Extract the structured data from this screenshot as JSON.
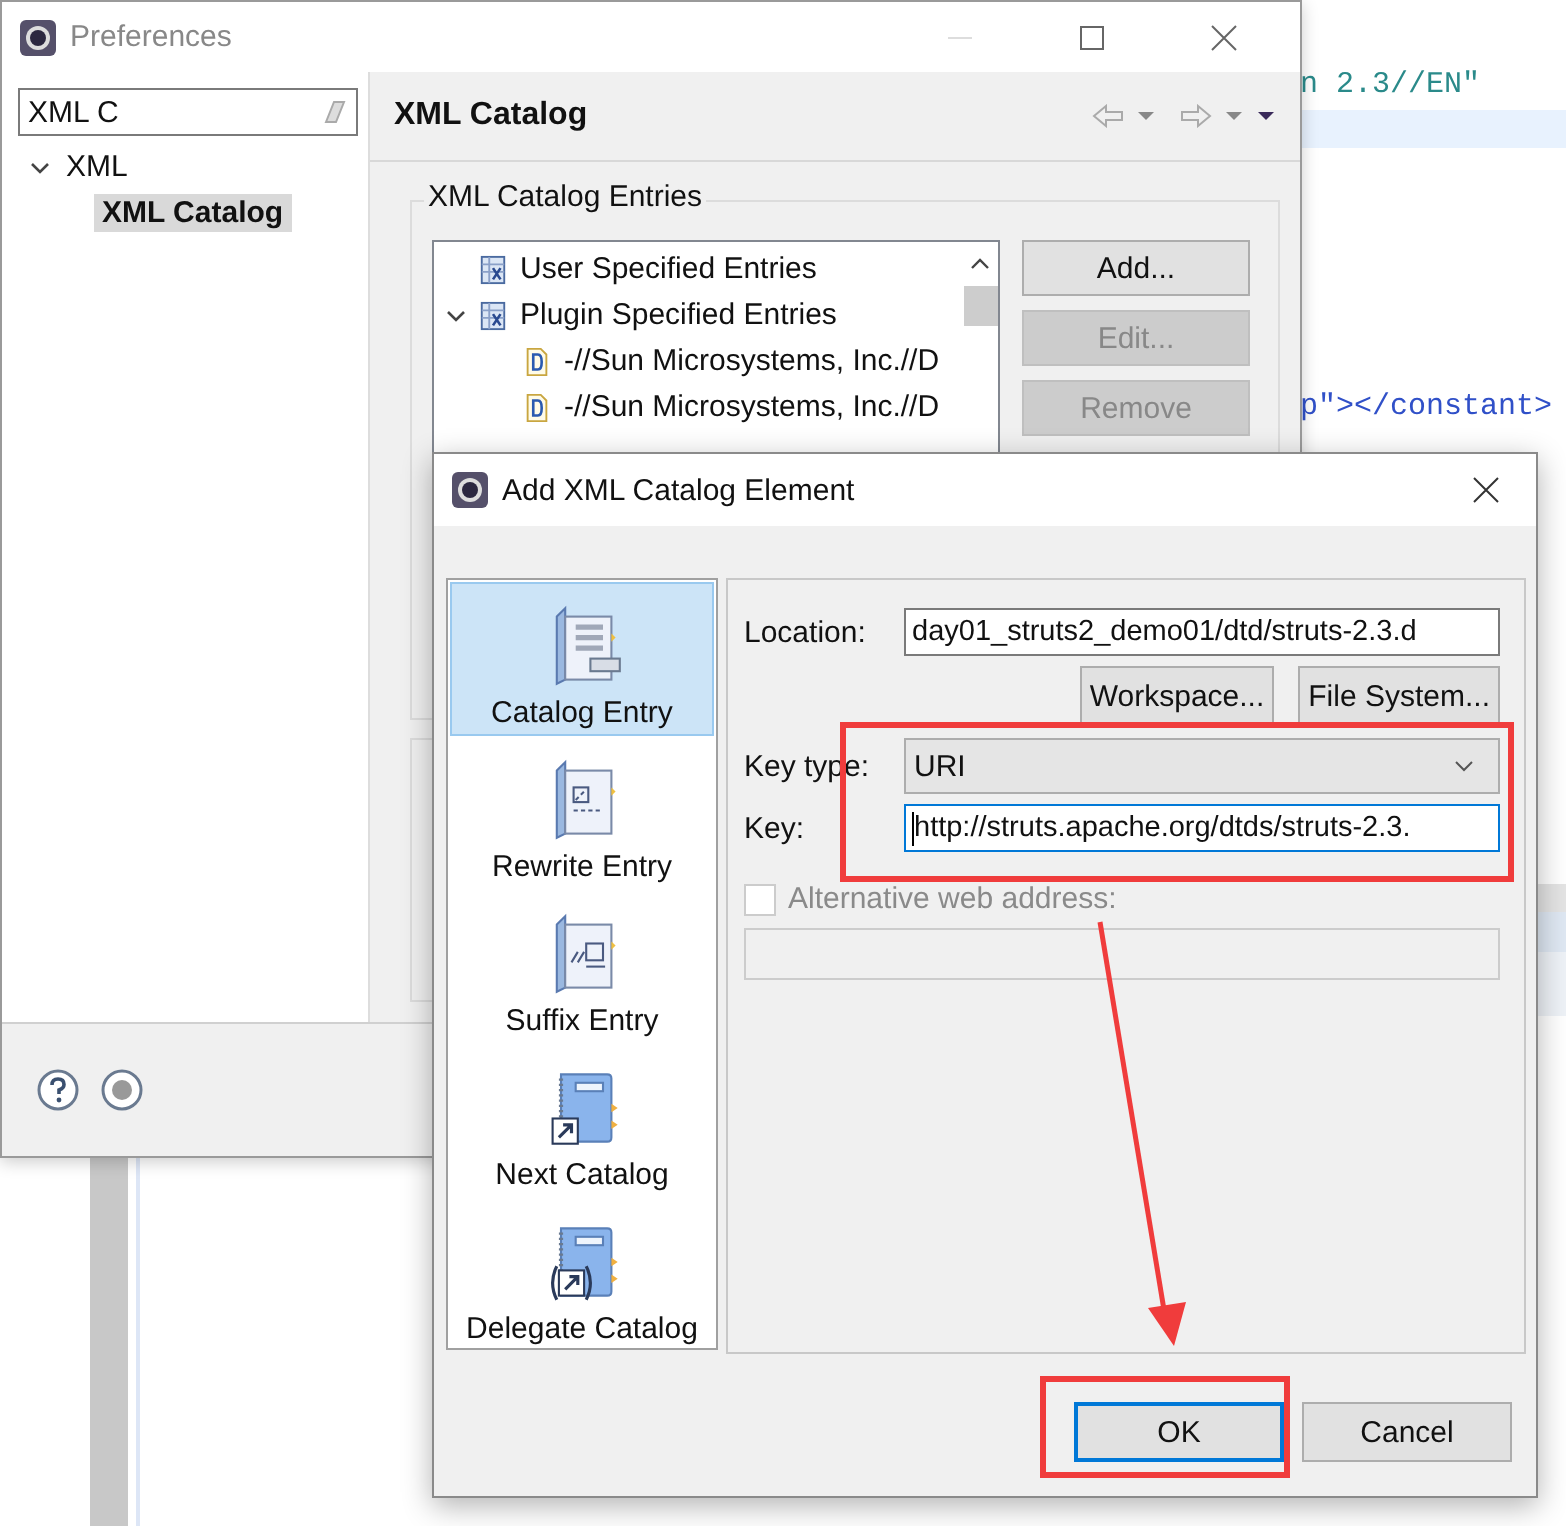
{
  "editor": {
    "lines": [
      {
        "text": "n 2.3//EN\"",
        "kind": "string"
      },
      {
        "text": "p\"></constant>",
        "kind": "tag"
      }
    ]
  },
  "preferences": {
    "title": "Preferences",
    "filter": {
      "value": "XML C"
    },
    "tree": [
      {
        "label": "XML",
        "expanded": true,
        "children": [
          {
            "label": "XML Catalog",
            "selected": true
          }
        ]
      }
    ],
    "page_title": "XML Catalog",
    "group_title": "XML Catalog Entries",
    "entries": [
      {
        "label": "User Specified Entries",
        "kind": "catalog"
      },
      {
        "label": "Plugin Specified Entries",
        "kind": "catalog",
        "expanded": true,
        "children": [
          {
            "label": "-//Sun Microsystems, Inc.//D",
            "kind": "dtd"
          },
          {
            "label": "-//Sun Microsystems, Inc.//D",
            "kind": "dtd"
          }
        ]
      }
    ],
    "buttons": [
      {
        "label": "Add...",
        "disabled": false
      },
      {
        "label": "Edit...",
        "disabled": true
      },
      {
        "label": "Remove",
        "disabled": true
      }
    ]
  },
  "dialog": {
    "title": "Add XML Catalog Element",
    "types": [
      {
        "label": "Catalog Entry",
        "kind": "entry",
        "selected": true
      },
      {
        "label": "Rewrite Entry",
        "kind": "rewrite",
        "selected": false
      },
      {
        "label": "Suffix Entry",
        "kind": "suffix",
        "selected": false
      },
      {
        "label": "Next Catalog",
        "kind": "next",
        "selected": false
      },
      {
        "label": "Delegate Catalog",
        "kind": "delegate",
        "selected": false
      }
    ],
    "location": {
      "label": "Location:",
      "value": "day01_struts2_demo01/dtd/struts-2.3.d"
    },
    "browse_buttons": [
      "Workspace...",
      "File System..."
    ],
    "key_type": {
      "label": "Key type:",
      "value": "URI"
    },
    "key": {
      "label": "Key:",
      "value": "http://struts.apache.org/dtds/struts-2.3.",
      "focused": true
    },
    "alternative": {
      "label": "Alternative web address:",
      "checked": false,
      "disabled": true
    },
    "buttons": [
      {
        "label": "OK",
        "default": true
      },
      {
        "label": "Cancel",
        "default": false
      }
    ]
  }
}
